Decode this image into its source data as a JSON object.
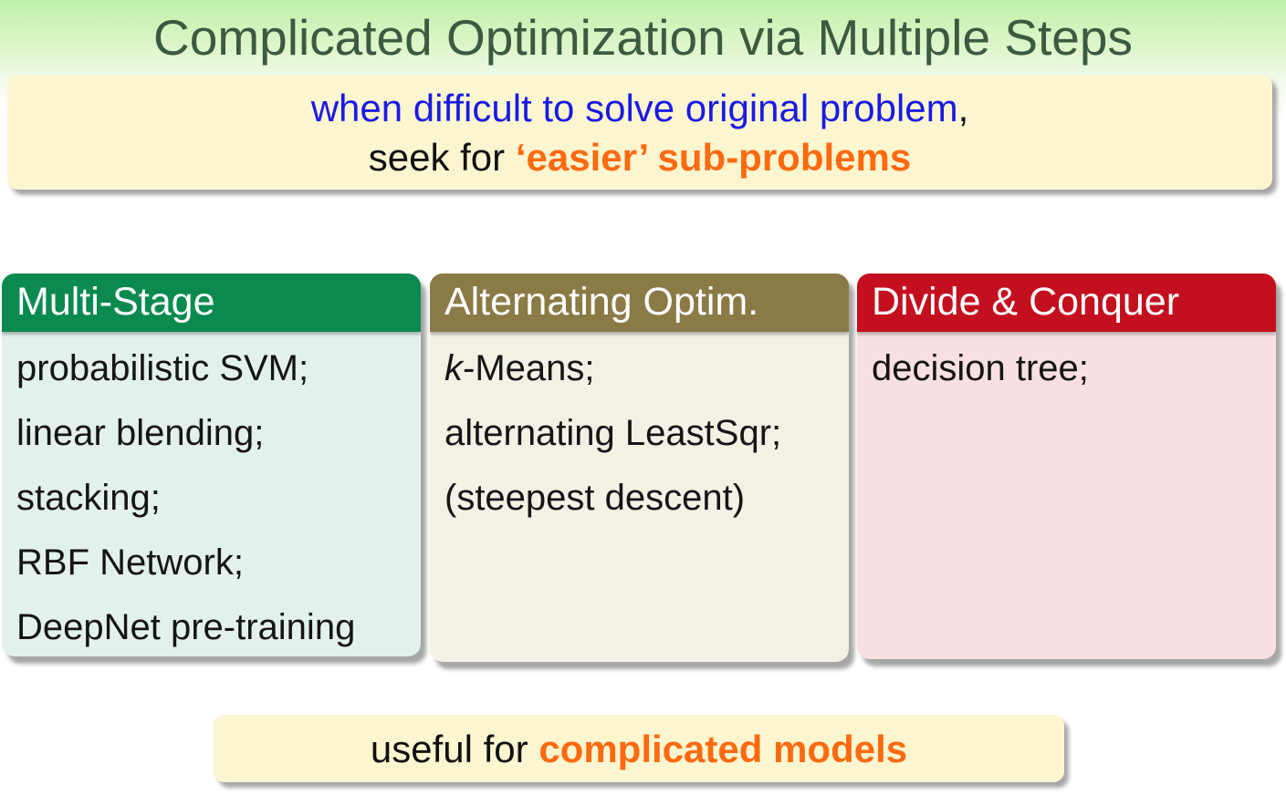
{
  "title": "Complicated Optimization via Multiple Steps",
  "intro": {
    "line1_blue": "when difficult to solve original problem",
    "line1_comma": ",",
    "line2_prefix": "seek for ",
    "line2_highlight": "‘easier’ sub-problems"
  },
  "panels": [
    {
      "heading": "Multi-Stage",
      "items": [
        "probabilistic SVM;",
        "linear blending;",
        "stacking;",
        "RBF Network;",
        "DeepNet pre-training"
      ]
    },
    {
      "heading": "Alternating Optim.",
      "items_first_italic": "k",
      "items_first_rest": "-Means;",
      "items": [
        "alternating LeastSqr;",
        "(steepest descent)"
      ]
    },
    {
      "heading": "Divide & Conquer",
      "items": [
        "decision tree;"
      ]
    }
  ],
  "footer": {
    "prefix": "useful for ",
    "highlight": "complicated models"
  },
  "colors": {
    "multi_stage": "#0b8a4f",
    "alternating": "#8a7a46",
    "divide_conquer": "#c40f1e",
    "highlight_orange": "#ff6a10",
    "emphasis_blue": "#1a1ae6"
  }
}
